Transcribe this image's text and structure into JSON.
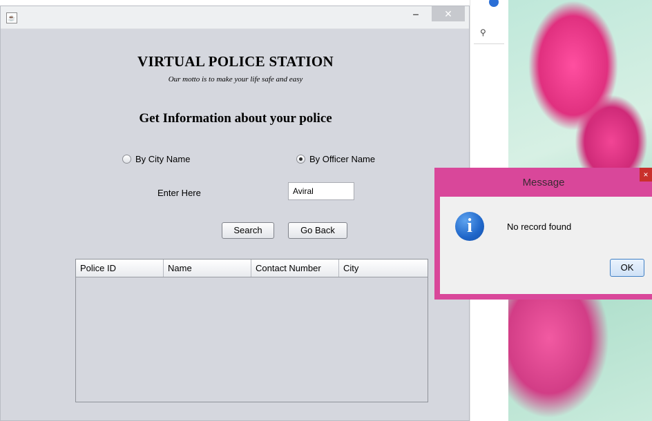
{
  "window": {
    "icon": "java-cup-icon",
    "controls": {
      "minimize": "‒",
      "maximize": "□",
      "close": "✕"
    }
  },
  "header": {
    "title": "VIRTUAL POLICE STATION",
    "motto": "Our motto is to make your life safe and easy",
    "subtitle": "Get Information about your police"
  },
  "search_mode": {
    "options": [
      {
        "label": "By City Name",
        "selected": false
      },
      {
        "label": "By Officer Name",
        "selected": true
      }
    ]
  },
  "input": {
    "label": "Enter Here",
    "value": "Aviral"
  },
  "buttons": {
    "search": "Search",
    "go_back": "Go Back"
  },
  "table": {
    "columns": [
      "Police ID",
      "Name",
      "Contact Number",
      "City"
    ],
    "rows": []
  },
  "dialog": {
    "title": "Message",
    "message": "No record found",
    "ok": "OK",
    "close": "×",
    "icon": "information-icon",
    "icon_glyph": "i"
  },
  "background_app": {
    "search_glyph": "⚲"
  },
  "colors": {
    "dialog_frame": "#d9479a",
    "window_bg": "#d5d7de",
    "info_icon": "#1f66c9"
  }
}
